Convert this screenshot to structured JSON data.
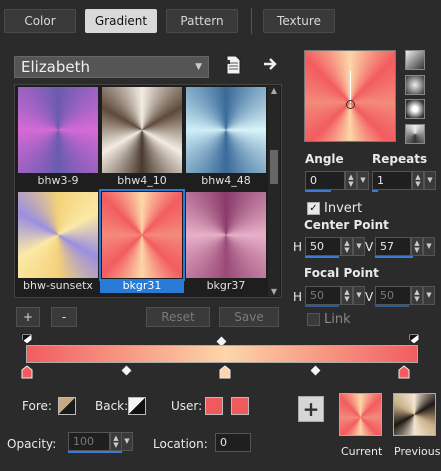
{
  "tabs": [
    {
      "label": "Color",
      "active": false
    },
    {
      "label": "Gradient",
      "active": true
    },
    {
      "label": "Pattern",
      "active": false
    },
    {
      "label": "Texture",
      "active": false
    }
  ],
  "library": {
    "selected": "Elizabeth",
    "icons": [
      "new-document-icon",
      "arrow-right-icon"
    ]
  },
  "gradients": [
    {
      "label": "bhw3-9",
      "selected": false
    },
    {
      "label": "bhw4_10",
      "selected": false
    },
    {
      "label": "bhw4_48",
      "selected": false
    },
    {
      "label": "bhw-sunsetx",
      "selected": false
    },
    {
      "label": "bkgr31",
      "selected": true
    },
    {
      "label": "bkgr37",
      "selected": false
    }
  ],
  "gallery_buttons": {
    "add": "+",
    "remove": "-",
    "reset": "Reset",
    "save": "Save"
  },
  "angle": {
    "label": "Angle",
    "value": "0"
  },
  "repeats": {
    "label": "Repeats",
    "value": "1"
  },
  "invert": {
    "label": "Invert",
    "checked": true
  },
  "center_point": {
    "label": "Center Point",
    "h_label": "H",
    "h_value": "50",
    "v_label": "V",
    "v_value": "57"
  },
  "focal_point": {
    "label": "Focal Point",
    "h_label": "H",
    "h_value": "50",
    "v_label": "V",
    "v_value": "50"
  },
  "link": {
    "label": "Link",
    "checked": false
  },
  "fore": {
    "label": "Fore:"
  },
  "back": {
    "label": "Back:"
  },
  "user": {
    "label": "User:",
    "colors": [
      "#f05a5e",
      "#f05a5e"
    ]
  },
  "opacity": {
    "label": "Opacity:",
    "value": "100"
  },
  "location": {
    "label": "Location:",
    "value": "0"
  },
  "compare": {
    "current": "Current",
    "previous": "Previous"
  },
  "colors": {
    "background": "#2b2b2b",
    "accent": "#2a7bd8",
    "gradient_start": "#f25c60",
    "gradient_end": "#fcd6a8"
  }
}
